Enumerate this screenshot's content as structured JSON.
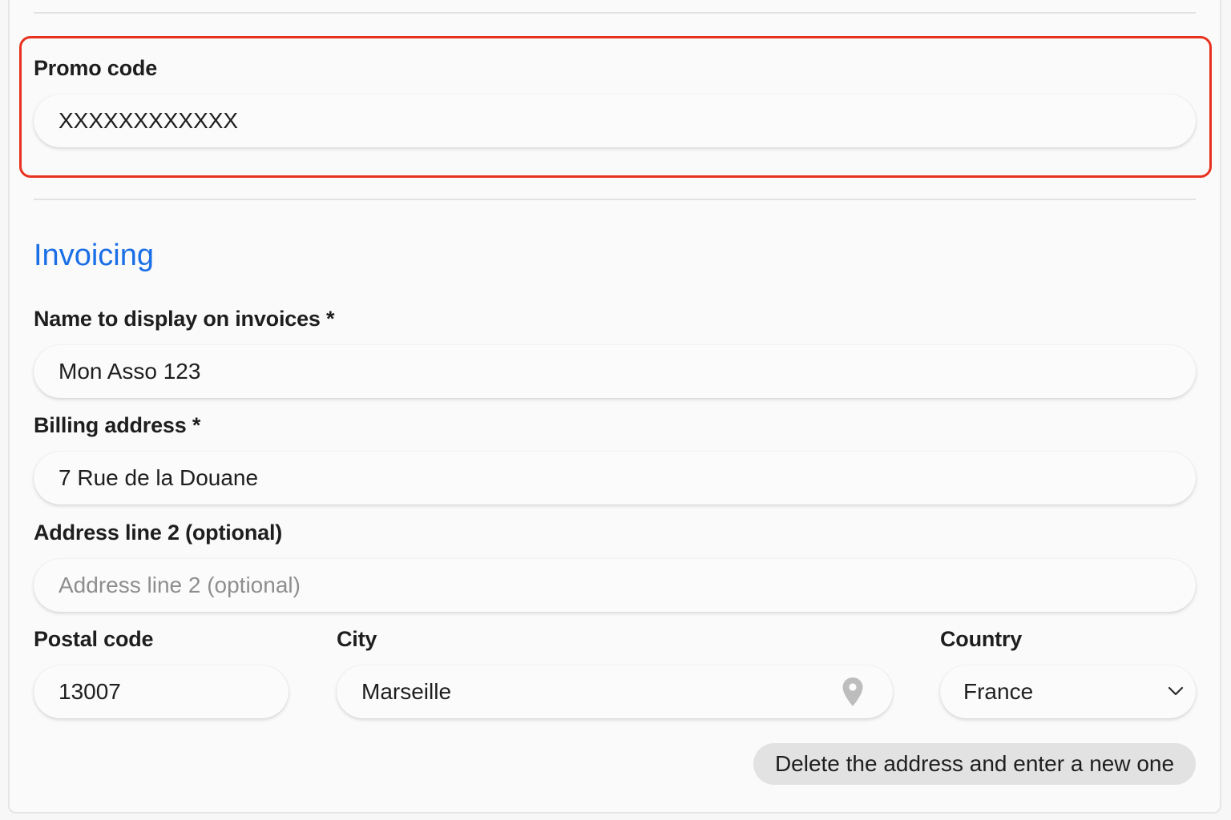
{
  "promo": {
    "label": "Promo code",
    "value": "XXXXXXXXXXXX"
  },
  "invoicing": {
    "section_title": "Invoicing",
    "name": {
      "label": "Name to display on invoices *",
      "value": "Mon Asso 123"
    },
    "billing_address": {
      "label": "Billing address *",
      "value": "7 Rue de la Douane"
    },
    "address_line2": {
      "label": "Address line 2 (optional)",
      "placeholder": "Address line 2 (optional)"
    },
    "postal_code": {
      "label": "Postal code",
      "value": "13007"
    },
    "city": {
      "label": "City",
      "value": "Marseille",
      "icon": "map-pin-icon"
    },
    "country": {
      "label": "Country",
      "value": "France",
      "icon": "chevron-down-icon"
    },
    "delete_button_label": "Delete the address and enter a new one"
  },
  "colors": {
    "highlight": "#e8311e",
    "section_title": "#1a6fe6",
    "button_bg": "#e2e2e2"
  }
}
